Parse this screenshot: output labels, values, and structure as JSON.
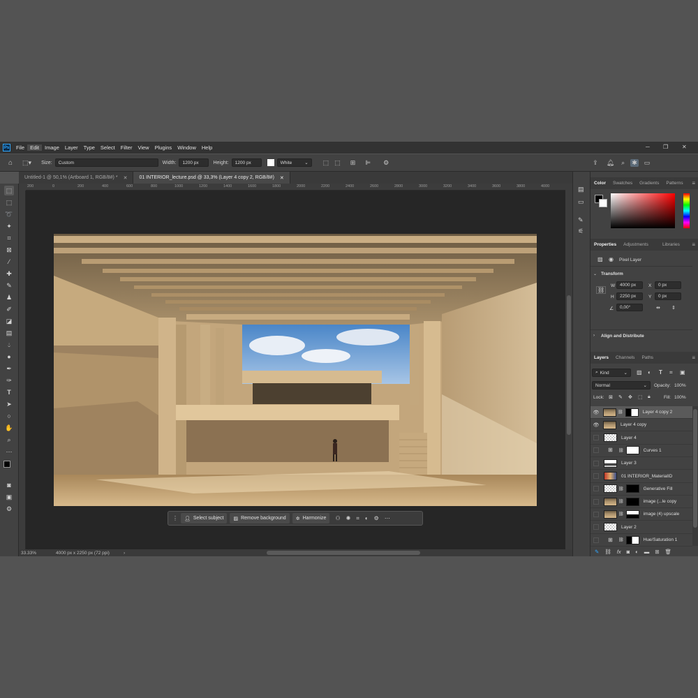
{
  "menu": {
    "logo": "Ps",
    "items": [
      "File",
      "Edit",
      "Image",
      "Layer",
      "Type",
      "Select",
      "Filter",
      "View",
      "Plugins",
      "Window",
      "Help"
    ]
  },
  "options": {
    "size_label": "Size:",
    "size_value": "Custom",
    "width_label": "Width:",
    "width_value": "1200 px",
    "height_label": "Height:",
    "height_value": "1200 px",
    "fill_value": "White"
  },
  "tabs": [
    {
      "label": "Untitled-1 @ 50,1% (Artboard 1, RGB/8#) *",
      "active": false
    },
    {
      "label": "01 INTERIOR_lecture.psd @ 33,3% (Layer 4 copy 2, RGB/8#)",
      "active": true
    }
  ],
  "ruler_ticks": [
    "200",
    "0",
    "200",
    "400",
    "600",
    "800",
    "1000",
    "1200",
    "1400",
    "1600",
    "1800",
    "2000",
    "2200",
    "2400",
    "2600",
    "2800",
    "3000",
    "3200",
    "3400",
    "3600",
    "3800",
    "4000"
  ],
  "context_bar": {
    "select_subject": "Select subject",
    "remove_background": "Remove background",
    "harmonize": "Harmonize"
  },
  "status": {
    "zoom": "33.33%",
    "doc_info": "4000 px x 2250 px (72 ppi)"
  },
  "color_panel": {
    "tabs": [
      "Color",
      "Swatches",
      "Gradients",
      "Patterns"
    ]
  },
  "properties": {
    "tabs": [
      "Properties",
      "Adjustments",
      "Libraries"
    ],
    "kind": "Pixel Layer",
    "transform_title": "Transform",
    "w_label": "W",
    "w_value": "4000 px",
    "h_label": "H",
    "h_value": "2250 px",
    "x_label": "X",
    "x_value": "0 px",
    "y_label": "Y",
    "y_value": "0 px",
    "angle_value": "0,00°",
    "align_title": "Align and Distribute"
  },
  "layers_panel": {
    "tabs": [
      "Layers",
      "Channels",
      "Paths"
    ],
    "filter": "Kind",
    "blend_mode": "Normal",
    "opacity_label": "Opacity:",
    "opacity_value": "100%",
    "lock_label": "Lock:",
    "fill_label": "Fill:",
    "fill_value": "100%",
    "layers": [
      {
        "name": "Layer 4 copy 2",
        "visible": true,
        "selected": true,
        "thumb": "photo",
        "mask": "black-white"
      },
      {
        "name": "Layer 4 copy",
        "visible": true,
        "selected": false,
        "thumb": "photo",
        "mask": ""
      },
      {
        "name": "Layer 4",
        "visible": false,
        "selected": false,
        "thumb": "checker",
        "mask": ""
      },
      {
        "name": "Curves 1",
        "visible": false,
        "selected": false,
        "thumb": "adjust",
        "mask": "white"
      },
      {
        "name": "Layer 3",
        "visible": false,
        "selected": false,
        "thumb": "dark",
        "mask": ""
      },
      {
        "name": "01 INTERIOR_MaterialID",
        "visible": false,
        "selected": false,
        "thumb": "material",
        "mask": ""
      },
      {
        "name": "Generative Fill",
        "visible": false,
        "selected": false,
        "thumb": "checker",
        "mask": "black"
      },
      {
        "name": "image (...le copy",
        "visible": false,
        "selected": false,
        "thumb": "photo",
        "mask": "black"
      },
      {
        "name": "image (4) upscale",
        "visible": false,
        "selected": false,
        "thumb": "photo",
        "mask": "white-black"
      },
      {
        "name": "Layer 2",
        "visible": false,
        "selected": false,
        "thumb": "checker",
        "mask": ""
      },
      {
        "name": "Hue/Saturation 1",
        "visible": false,
        "selected": false,
        "thumb": "adjust",
        "mask": "black-white"
      }
    ]
  }
}
